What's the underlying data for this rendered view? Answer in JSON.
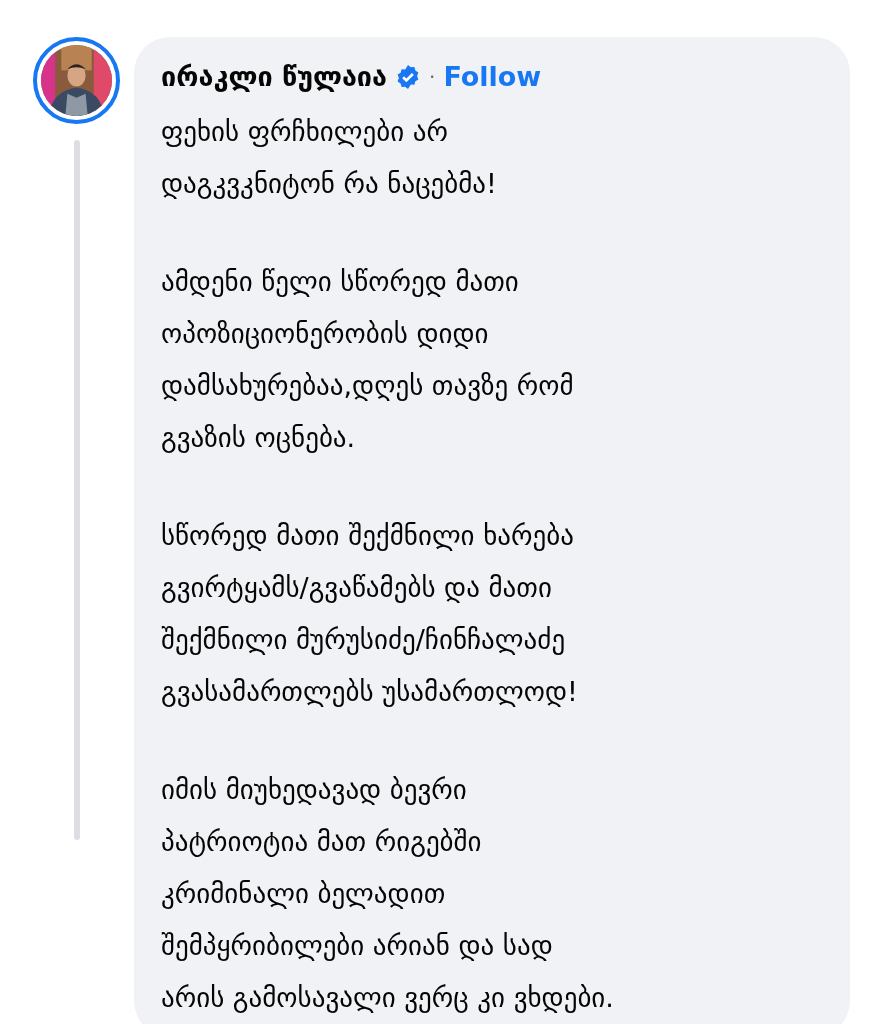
{
  "comment": {
    "author": "ირაკლი წულაია",
    "verified": true,
    "follow_label": "Follow",
    "separator": "·",
    "paragraphs": [
      {
        "lines": [
          "ფეხის ფრჩხილები არ",
          "დაგკვკნიტონ რა ნაცებმა!"
        ]
      },
      {
        "lines": [
          "ამდენი წელი სწორედ მათი",
          "ოპოზიციონერობის დიდი",
          "დამსახურებაა,დღეს თავზე რომ",
          "გვაზის ოცნება."
        ]
      },
      {
        "lines": [
          "სწორედ მათი შექმნილი ხარება",
          "გვირტყამს/გვაწამებს და მათი",
          "შექმნილი მურუსიძე/ჩინჩალაძე",
          "გვასამართლებს უსამართლოდ!"
        ]
      },
      {
        "lines": [
          "იმის მიუხედავად ბევრი",
          "პატრიოტია მათ რიგებში",
          "კრიმინალი ბელადით",
          "შემპყრიბილები არიან და სად",
          "არის გამოსავალი ვერც კი ვხდები."
        ]
      }
    ]
  }
}
